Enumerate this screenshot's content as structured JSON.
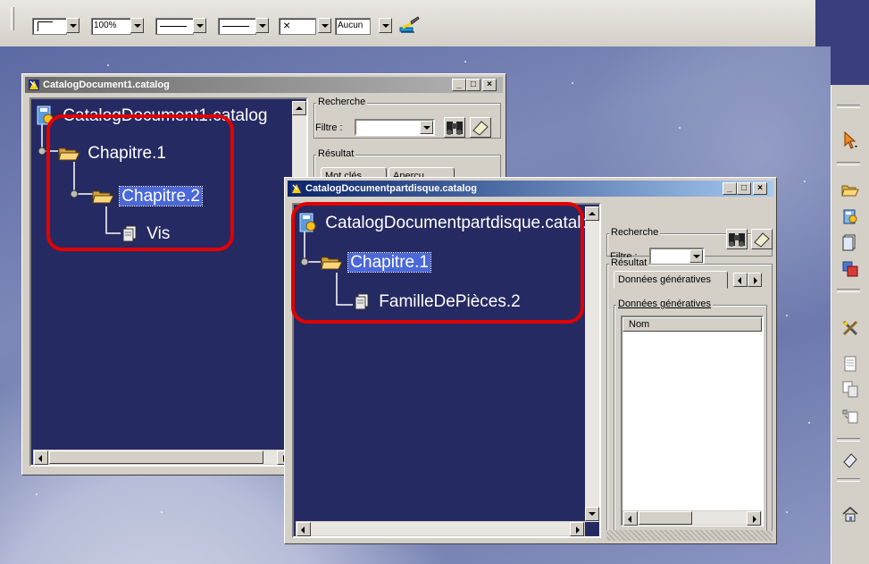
{
  "toolbar": {
    "zoom_value": "100%",
    "line_type_1": "",
    "line_type_2": "",
    "point_symbol": "×",
    "layer_value": "Aucun"
  },
  "window1": {
    "title": "CatalogDocument1.catalog",
    "tree": {
      "root": "CatalogDocument1.catalog",
      "chapter1": "Chapitre.1",
      "chapter2": "Chapitre.2",
      "leaf": "Vis"
    },
    "side": {
      "search_group": "Recherche",
      "filter_label": "Filtre :",
      "result_group": "Résultat",
      "tab1": "Mot clés",
      "tab2": "Aperçu"
    }
  },
  "window2": {
    "title": "CatalogDocumentpartdisque.catalog",
    "tree": {
      "root": "CatalogDocumentpartdisque.catalog",
      "chapter1": "Chapitre.1",
      "leaf": "FamilleDePièces.2"
    },
    "side": {
      "search_group": "Recherche",
      "filter_label": "Filtre :",
      "result_group": "Résultat",
      "tab1": "Données génératives",
      "list_group": "Données génératives",
      "column_header": "Nom"
    }
  },
  "colors": {
    "tree_background": "#262a62",
    "highlight_outline": "#e30000",
    "active_titlebar": "#0a246a",
    "selection": "#4a68d8"
  },
  "vertical_toolbar_icons": [
    "select-arrow-icon",
    "open-folder-icon",
    "catalog-icon",
    "document-icon",
    "multi-document-icon",
    "crossed-tools-icon",
    "page-icon",
    "copy-page-icon",
    "keyword-page-icon",
    "eraser-icon",
    "house-icon"
  ]
}
